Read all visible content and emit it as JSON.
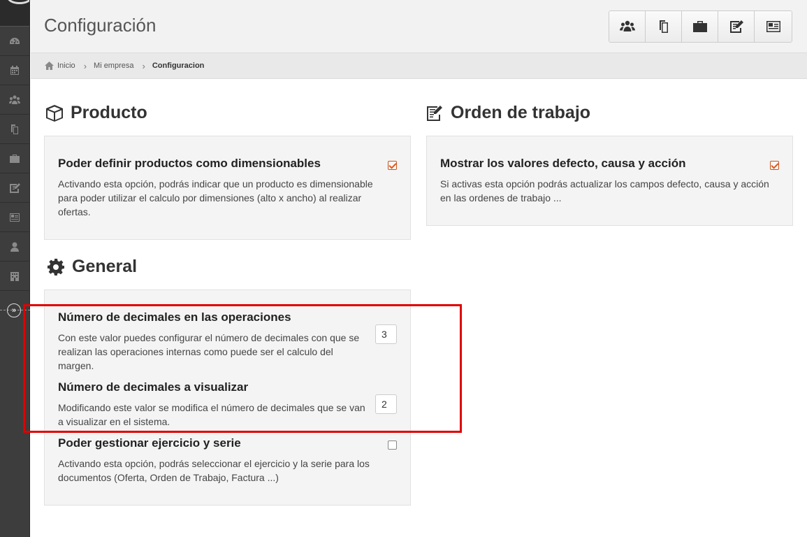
{
  "header": {
    "title": "Configuración"
  },
  "toolbar": {
    "buttons": [
      {
        "icon": "users-icon"
      },
      {
        "icon": "documents-icon"
      },
      {
        "icon": "briefcase-icon"
      },
      {
        "icon": "edit-icon"
      },
      {
        "icon": "contact-card-icon"
      }
    ]
  },
  "breadcrumb": {
    "items": [
      "Inicio",
      "Mi empresa",
      "Configuracion"
    ]
  },
  "sidebar": {
    "icons": [
      "dashboard-icon",
      "calendar-icon",
      "users-icon",
      "documents-icon",
      "briefcase-icon",
      "edit-icon",
      "contact-card-icon",
      "user-icon",
      "building-icon"
    ]
  },
  "producto": {
    "title": "Producto",
    "option": {
      "title": "Poder definir productos como dimensionables",
      "description": "Activando esta opción, podrás indicar que un producto es dimensionable para poder utilizar el calculo por dimensiones (alto x ancho) al realizar ofertas.",
      "checked": true
    }
  },
  "orden": {
    "title": "Orden de trabajo",
    "option": {
      "title": "Mostrar los valores defecto, causa y acción",
      "description": "Si activas esta opción podrás actualizar los campos defecto, causa y acción en las ordenes de trabajo ...",
      "checked": true
    }
  },
  "general": {
    "title": "General",
    "decimales_operaciones": {
      "title": "Número de decimales en las operaciones",
      "description": "Con este valor puedes configurar el número de decimales con que se realizan las operaciones internas como puede ser el calculo del margen.",
      "value": "3"
    },
    "decimales_visualizar": {
      "title": "Número de decimales a visualizar",
      "description": "Modificando este valor se modifica el número de decimales que se van a visualizar en el sistema.",
      "value": "2"
    },
    "ejercicio_serie": {
      "title": "Poder gestionar ejercicio y serie",
      "description": "Activando esta opción, podrás seleccionar el ejercicio y la serie para los documentos (Oferta, Orden de Trabajo, Factura ...)",
      "checked": false
    }
  },
  "colors": {
    "accent": "#e05a1a",
    "highlight": "#e00000",
    "sidebar": "#3d3d3d"
  }
}
